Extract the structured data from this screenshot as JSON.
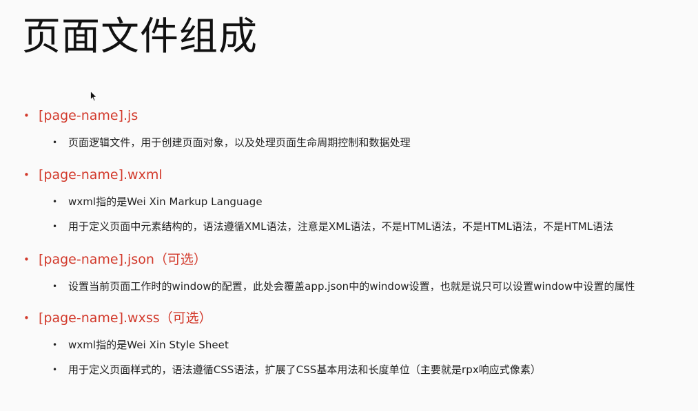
{
  "slide": {
    "title": "页面文件组成",
    "accent_color": "#d2392b",
    "text_color": "#222222",
    "background": "#fafafa"
  },
  "sections": [
    {
      "heading": "[page-name].js",
      "items": [
        "页面逻辑文件，用于创建页面对象，以及处理页面生命周期控制和数据处理"
      ]
    },
    {
      "heading": "[page-name].wxml",
      "items": [
        "wxml指的是Wei Xin Markup Language",
        "用于定义页面中元素结构的，语法遵循XML语法，注意是XML语法，不是HTML语法，不是HTML语法，不是HTML语法"
      ]
    },
    {
      "heading": "[page-name].json（可选）",
      "items": [
        "设置当前页面工作时的window的配置，此处会覆盖app.json中的window设置，也就是说只可以设置window中设置的属性"
      ]
    },
    {
      "heading": "[page-name].wxss（可选）",
      "items": [
        "wxml指的是Wei Xin Style Sheet",
        "用于定义页面样式的，语法遵循CSS语法，扩展了CSS基本用法和长度单位（主要就是rpx响应式像素）"
      ]
    }
  ],
  "icons": {
    "cursor": "mouse-pointer-icon",
    "level1_bullet": "•",
    "level2_bullet": "•"
  }
}
